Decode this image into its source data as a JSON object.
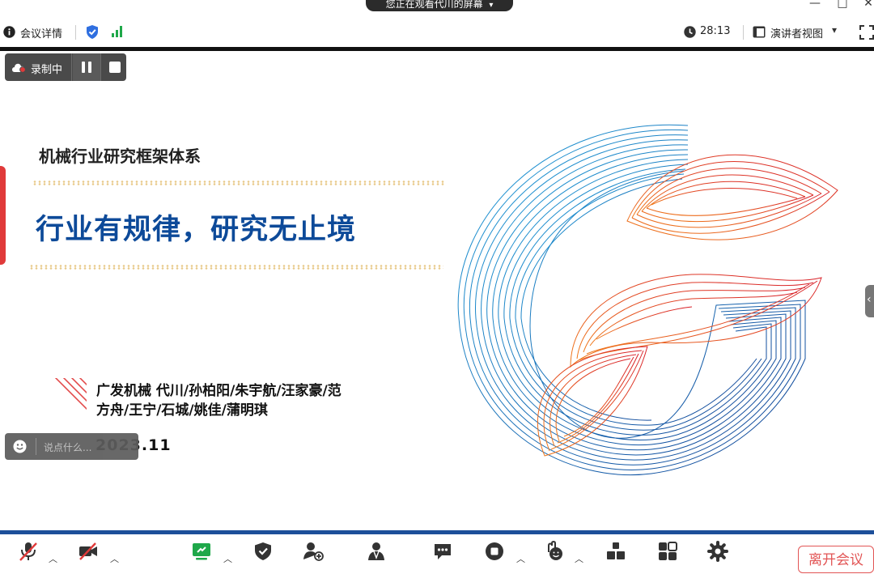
{
  "window": {
    "share_banner": "您正在观看代川的屏幕",
    "minimize_glyph": "—",
    "maximize_glyph": "□",
    "close_glyph": "✕"
  },
  "infobar": {
    "meeting_details_label": "会议详情",
    "timer": "28:13",
    "view_mode_label": "演讲者视图"
  },
  "recording": {
    "label": "录制中"
  },
  "slide": {
    "framework_title": "机械行业研究框架体系",
    "slogan": "行业有规律，研究无止境",
    "authors_line1": "广发机械 代川/孙柏阳/朱宇航/汪家豪/范",
    "authors_line2": "方舟/王宁/石城/姚佳/蒲明琪",
    "date": "2023.11"
  },
  "chat": {
    "placeholder": "说点什么..."
  },
  "toolbar": {
    "leave_label": "离开会议"
  },
  "icons": [
    "info-icon",
    "shield-icon",
    "signal-icon",
    "clock-icon",
    "layout-icon",
    "chevron-down-icon",
    "fullscreen-icon",
    "cloud-record-icon",
    "pause-icon",
    "stop-icon",
    "smile-icon",
    "mic-muted-icon",
    "video-muted-icon",
    "share-screen-icon",
    "security-icon",
    "invite-icon",
    "participants-icon",
    "chat-icon",
    "record-icon",
    "reaction-icon",
    "apps-icon",
    "more-apps-icon",
    "settings-icon"
  ],
  "colors": {
    "brand_blue": "#0d4a99",
    "brand_red": "#e03a3a",
    "accent_green": "#1fa84a",
    "bottom_stripe": "#1d4f9a"
  }
}
